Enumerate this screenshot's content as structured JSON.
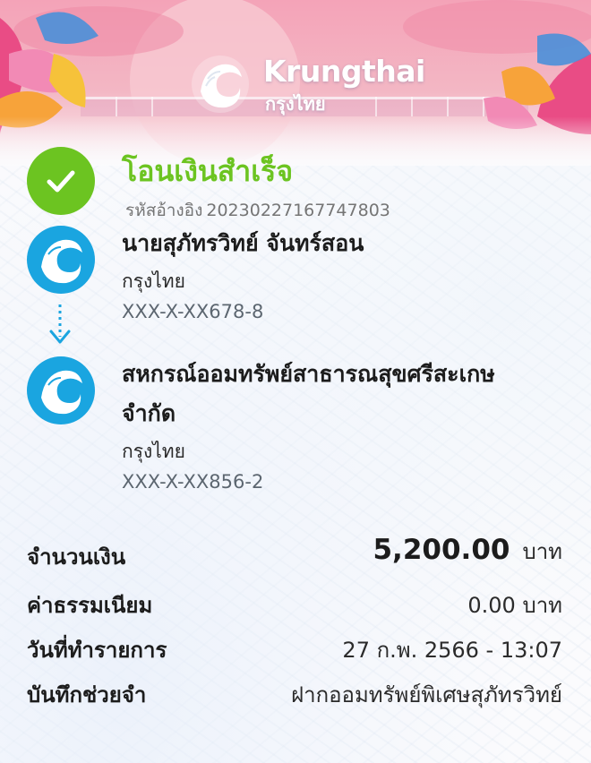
{
  "brand": {
    "name_en": "Krungthai",
    "name_th": "กรุงไทย"
  },
  "status": {
    "title": "โอนเงินสำเร็จ",
    "icon": "check-icon",
    "color": "#6cc421"
  },
  "reference": {
    "label": "รหัสอ้างอิง",
    "value": "20230227167747803"
  },
  "sender": {
    "name": "นายสุภัทรวิทย์ จันทร์สอน",
    "bank": "กรุงไทย",
    "account": "XXX-X-XX678-8"
  },
  "receiver": {
    "name_line1": "สหกรณ์ออมทรัพย์สาธารณสุขศรีสะเกษ",
    "name_line2": "จำกัด",
    "bank": "กรุงไทย",
    "account": "XXX-X-XX856-2"
  },
  "details": {
    "amount_label": "จำนวนเงิน",
    "amount_value": "5,200.00",
    "amount_unit": "บาท",
    "fee_label": "ค่าธรรมเนียม",
    "fee_value": "0.00 บาท",
    "date_label": "วันที่ทำรายการ",
    "date_value": "27 ก.พ. 2566 - 13:07",
    "memo_label": "บันทึกช่วยจำ",
    "memo_value": "ฝากออมทรัพย์พิเศษสุภัทรวิทย์"
  },
  "colors": {
    "bank_blue": "#1aa5e0",
    "success_green": "#6cc421"
  }
}
